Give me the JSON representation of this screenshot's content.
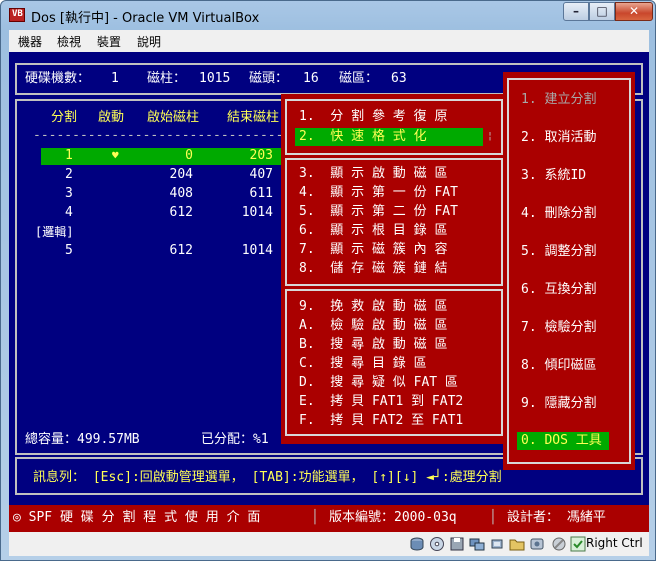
{
  "window": {
    "title": "Dos [執行中] - Oracle VM VirtualBox",
    "icon_text": "VB",
    "buttons": {
      "min": "–",
      "max": "□",
      "close": "✕"
    }
  },
  "menu": [
    "機器",
    "檢視",
    "裝置",
    "說明"
  ],
  "header": {
    "disks_label": "硬碟機數：",
    "disks_value": "1",
    "cyl_label": "磁柱：",
    "cyl_value": "1015",
    "head_label": "磁頭：",
    "head_value": "16",
    "sector_label": "磁區：",
    "sector_value": "63"
  },
  "partition_table": {
    "columns": [
      "分割",
      "啟動",
      "啟始磁柱",
      "結束磁柱"
    ],
    "divider": "----------------------------------------",
    "rows": [
      {
        "num": "1",
        "boot": "♥",
        "start": "0",
        "end": "203",
        "selected": true
      },
      {
        "num": "2",
        "boot": "",
        "start": "204",
        "end": "407",
        "selected": false
      },
      {
        "num": "3",
        "boot": "",
        "start": "408",
        "end": "611",
        "selected": false
      },
      {
        "num": "4",
        "boot": "",
        "start": "612",
        "end": "1014",
        "selected": false
      }
    ],
    "logical_label": "[邏輯]",
    "logical_rows": [
      {
        "num": "5",
        "boot": "",
        "start": "612",
        "end": "1014"
      }
    ],
    "total_label": "總容量：499.57MB",
    "allocated_label": "已分配：%1"
  },
  "tools_menu": {
    "group1": [
      {
        "text": "1.  分 割 參 考 復 原",
        "selected": false
      },
      {
        "text": "2.  快 速 格 式 化",
        "selected": true
      }
    ],
    "group2": [
      "3.  顯 示 啟 動 磁 區",
      "4.  顯 示 第 一 份 FAT",
      "5.  顯 示 第 二 份 FAT",
      "6.  顯 示 根 目 錄 區",
      "7.  顯 示 磁 簇 內 容",
      "8.  儲 存 磁 簇 鏈 結"
    ],
    "group3": [
      "9.  挽 救 啟 動 磁 區",
      "A.  檢 驗 啟 動 磁 區",
      "B.  搜 尋 啟 動 磁 區",
      "C.  搜 尋 目 錄 區",
      "D.  搜 尋 疑 似 FAT 區",
      "E.  拷 貝 FAT1 到 FAT2",
      "F.  拷 貝 FAT2 至 FAT1"
    ]
  },
  "main_menu": [
    {
      "text": "1. 建立分割",
      "state": "disabled"
    },
    {
      "text": "2. 取消活動",
      "state": "normal"
    },
    {
      "text": "3. 系統ID",
      "state": "normal"
    },
    {
      "text": "4. 刪除分割",
      "state": "normal"
    },
    {
      "text": "5. 調整分割",
      "state": "normal"
    },
    {
      "text": "6. 互換分割",
      "state": "normal"
    },
    {
      "text": "7. 檢驗分割",
      "state": "normal"
    },
    {
      "text": "8. 傾印磁區",
      "state": "normal"
    },
    {
      "text": "9. 隱藏分割",
      "state": "normal"
    },
    {
      "text": "0. DOS 工具",
      "state": "selected"
    }
  ],
  "message_bar": "訊息列： [Esc]:回啟動管理選單， [TAB]:功能選單， [↑][↓] ◄┘:處理分割",
  "bottom_bar": {
    "left": "◎ SPF 硬 碟 分 割 程 式 使 用 介 面",
    "version": "版本編號：2000-03q",
    "author": "設計者： 馮緒平"
  },
  "vm_status": {
    "right_ctrl": "Right Ctrl"
  },
  "colors": {
    "screen_bg": "#000080",
    "menu_red": "#aa0000",
    "highlight_green": "#00aa00",
    "text_yellow": "#ffff55",
    "disabled_gray": "#a8a8a8"
  }
}
